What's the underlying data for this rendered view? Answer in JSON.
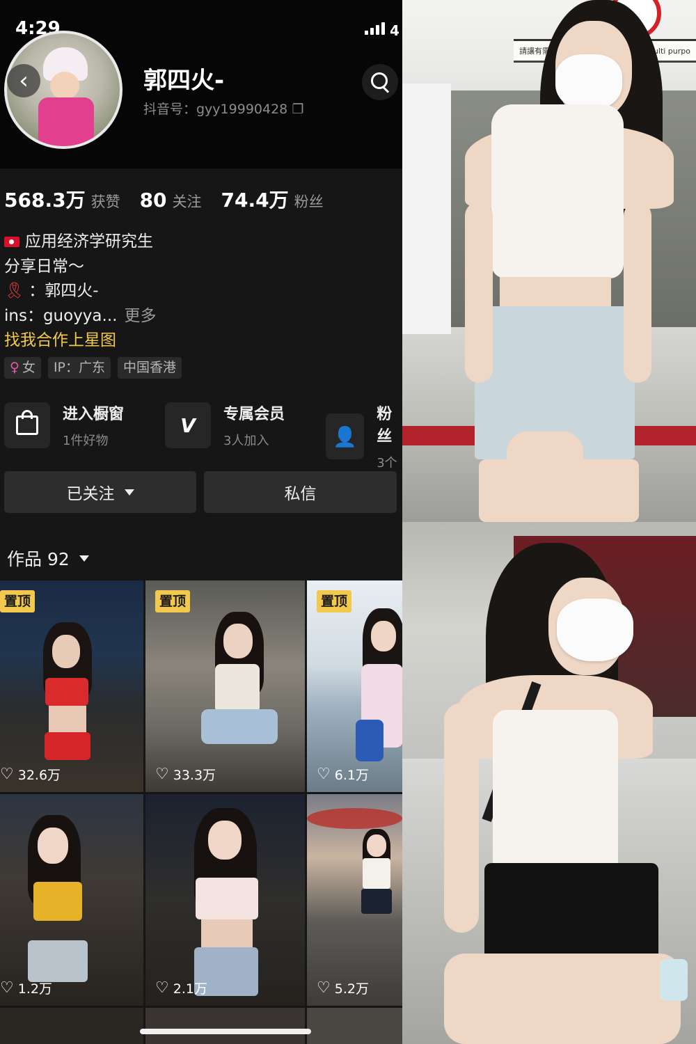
{
  "status": {
    "time": "4:29",
    "battery": "4"
  },
  "profile": {
    "name": "郭四火-",
    "douyin_id": "抖音号：gyy19990428"
  },
  "stats": [
    {
      "value": "568.3万",
      "label": "获赞"
    },
    {
      "value": "80",
      "label": "关注"
    },
    {
      "value": "74.4万",
      "label": "粉丝"
    }
  ],
  "bio": {
    "line1": "应用经济学研究生",
    "line2": "分享日常～",
    "line3": "：郭四火-",
    "line4": "ins：guoyya...",
    "more": "更多",
    "star_link": "找我合作上星图"
  },
  "tags": [
    "女",
    "IP：广东",
    "中国香港"
  ],
  "features": [
    {
      "title": "进入橱窗",
      "sub": "1件好物"
    },
    {
      "title": "专属会员",
      "sub": "3人加入"
    },
    {
      "title": "粉丝",
      "sub": "3个"
    }
  ],
  "buttons": {
    "follow": "已关注",
    "message": "私信"
  },
  "works": {
    "label": "作品 92"
  },
  "grid": [
    {
      "pinned": "置顶",
      "likes": "32.6万"
    },
    {
      "pinned": "置顶",
      "likes": "33.3万"
    },
    {
      "pinned": "置顶",
      "likes": "6.1万"
    },
    {
      "pinned": "",
      "likes": "1.2万"
    },
    {
      "pinned": "",
      "likes": "2.1万"
    },
    {
      "pinned": "",
      "likes": "5.2万"
    }
  ],
  "right_photo": {
    "sign_left": "請讓有需",
    "sign_right": "Multi purpo"
  }
}
